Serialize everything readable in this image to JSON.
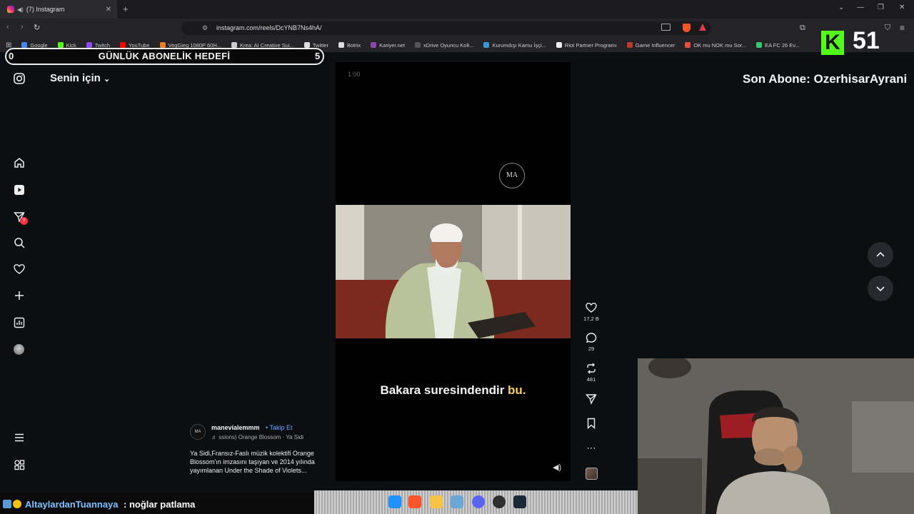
{
  "browser": {
    "tab_title": "(7) Instagram",
    "new_tab": "+",
    "url": "instagram.com/reels/DcYNB7Ns4hA/",
    "bookmarks": [
      {
        "label": "Google",
        "color": "#4285f4"
      },
      {
        "label": "Kick",
        "color": "#53fc18"
      },
      {
        "label": "Twitch",
        "color": "#9146ff"
      },
      {
        "label": "YouTube",
        "color": "#ff0000"
      },
      {
        "label": "VegGieg 1080P 60H...",
        "color": "#e67e22"
      },
      {
        "label": "Krea: AI Creative Sui...",
        "color": "#cccccc"
      },
      {
        "label": "Twitter",
        "color": "#dddddd"
      },
      {
        "label": "Botrix",
        "color": "#dddddd"
      },
      {
        "label": "Kariyer.net",
        "color": "#8e44ad"
      },
      {
        "label": "xDrive Oyuncu Kolt...",
        "color": "#555555"
      },
      {
        "label": "Kurumdışı Kamu İşçi...",
        "color": "#3498db"
      },
      {
        "label": "Riot Partner Programı",
        "color": "#eeeeee"
      },
      {
        "label": "Game Influencer",
        "color": "#c0392b"
      },
      {
        "label": "OK mu NOK mu Sor...",
        "color": "#e74c3c"
      },
      {
        "label": "EA FC 26 Ev...",
        "color": "#2ecc71"
      }
    ]
  },
  "overlay": {
    "goal_min": "0",
    "goal_title": "GÜNLÜK ABONELİK HEDEFİ",
    "goal_max": "5",
    "kick_letter": "K",
    "kick_count": "51",
    "last_sub": "Son Abone: OzerhisarAyrani"
  },
  "instagram": {
    "feed_label": "Senin için",
    "notif_count": "7",
    "reel": {
      "time": "1:00",
      "logo_text": "MA",
      "subtitle_main": "Bakara suresindendir",
      "subtitle_highlight": "bu."
    },
    "actions": {
      "likes": "17,2 B",
      "comments": "29",
      "reposts": "481"
    },
    "post": {
      "avatar_text": "MA",
      "username": "manevialemmm",
      "follow": "• Takip Et",
      "music": "♬ ssions)  Orange Blossom · Ya Sidi",
      "caption": "Ya Sidi,Fransız-Faslı müzik kolektifi Orange Blossom'ın imzasını taşıyan ve 2014 yılında yayımlanan Under the Shade of Violets..."
    }
  },
  "chat": {
    "username": "AltaylardanTuannaya",
    "message": ": noğlar patlama"
  }
}
